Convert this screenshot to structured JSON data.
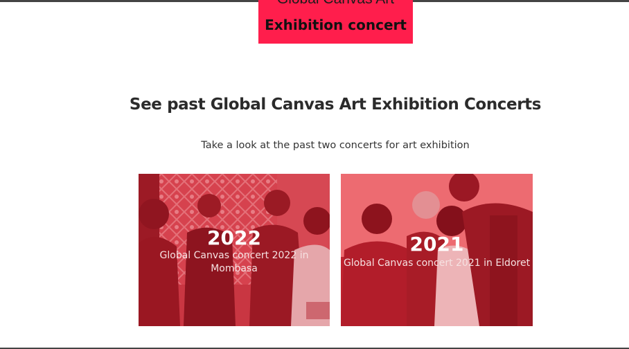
{
  "banner": {
    "line1": "Global Canvas Art",
    "line2": "Exhibition concert",
    "color": "#ff1e4c"
  },
  "section": {
    "heading": "See past Global Canvas Art Exhibition Concerts",
    "subtitle": "Take a look at the past two concerts for art exhibition"
  },
  "concerts": [
    {
      "year": "2022",
      "caption": "Global Canvas concert 2022 in Mombasa"
    },
    {
      "year": "2021",
      "caption": "Global Canvas concert 2021 in Eldoret"
    }
  ],
  "colors": {
    "card_tint": "#c8313c",
    "text_dark": "#2b2b2b"
  }
}
